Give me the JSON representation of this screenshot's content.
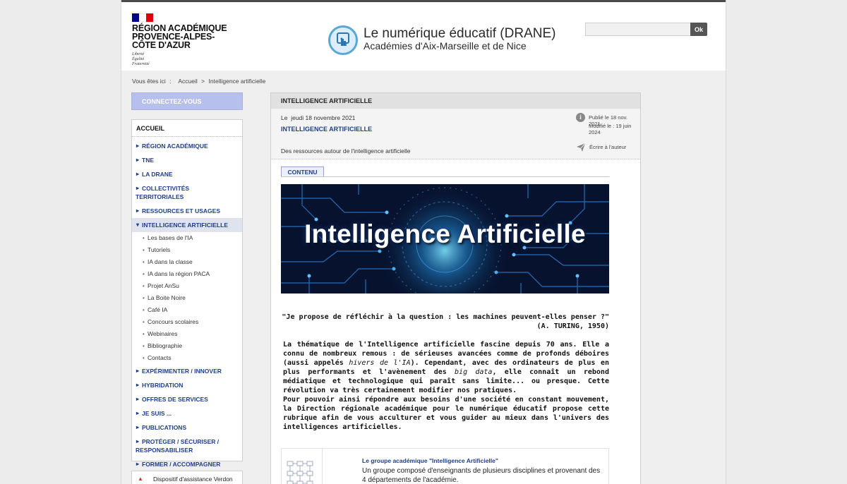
{
  "header": {
    "logo_lines": [
      "RÉGION ACADÉMIQUE",
      "PROVENCE-ALPES-",
      "CÔTE D'AZUR"
    ],
    "motto_lines": [
      "Liberté",
      "Égalité",
      "Fraternité"
    ],
    "site_title": "Le numérique éducatif (DRANE)",
    "site_subtitle": "Académies d'Aix-Marseille et de Nice",
    "search_button": "Ok",
    "search_value": ""
  },
  "breadcrumb": {
    "prefix": "Vous êtes ici",
    "separator": ":",
    "home": "Accueil",
    "arrow": ">",
    "current": "Intelligence artificielle"
  },
  "sidebar": {
    "connect_label": "CONNECTEZ-VOUS",
    "home_label": "ACCUEIL",
    "items": [
      {
        "label": "RÉGION ACADÉMIQUE"
      },
      {
        "label": "TNE"
      },
      {
        "label": "LA DRANE"
      },
      {
        "label": "COLLECTIVITÉS",
        "label2": "TERRITORIALES"
      },
      {
        "label": "RESSOURCES ET USAGES"
      },
      {
        "label": "INTELLIGENCE ARTIFICIELLE"
      },
      {
        "label": "EXPÉRIMENTER / INNOVER"
      },
      {
        "label": "HYBRIDATION"
      },
      {
        "label": "OFFRES DE SERVICES"
      },
      {
        "label": "JE SUIS ..."
      },
      {
        "label": "PUBLICATIONS"
      },
      {
        "label": "PROTÉGER / SÉCURISER /",
        "label2": "RESPONSABILISER"
      },
      {
        "label": "FORMER / ACCOMPAGNER"
      }
    ],
    "subitems": [
      "Les bases de l'IA",
      "Tutoriels",
      "IA dans la classe",
      "IA dans la région PACA",
      "Projet AnSu",
      "La Boite Noire",
      "Café IA",
      "Concours scolaires",
      "Webinaires",
      "Bibliographie",
      "Contacts"
    ],
    "assist_label": "Dispositif d'assistance Verdon"
  },
  "article": {
    "section_title": "INTELLIGENCE ARTIFICIELLE",
    "date_prefix": "Le",
    "date": "jeudi 18 novembre 2021",
    "title": "INTELLIGENCE ARTIFICIELLE",
    "description": "Des ressources autour de l'intelligence artificielle",
    "info_glyph": "i",
    "published": "Publié le 18 nov. 2021",
    "modified": "Modifié le : 19 juin 2024",
    "write_author": "Écrire à l'auteur",
    "tab_label": "CONTENU",
    "banner_title": "Intelligence Artificielle",
    "quote_line1": "\"Je propose de réfléchir à la question : les machines peuvent-elles penser ?\"",
    "quote_line2": "(A. TURING, 1950)",
    "para1_a": "La thématique de l'Intelligence artificielle fascine depuis 70 ans. Elle a connu de nombreux remous : de sérieuses avancées comme de profonds déboires (aussi appelés ",
    "para1_em1": "hivers de l'IA",
    "para1_b": "). Cependant, avec des ordinateurs de plus en plus performants et l'avènement des ",
    "para1_em2": "big data",
    "para1_c": ", elle connaît un rebond médiatique et technologique qui paraît sans limite... ou presque. Cette révolution va très certainement modifier nos pratiques.",
    "para2": "Pour pouvoir ainsi répondre aux besoins d'une société en constant mouvement, la Direction régionale académique pour le numérique éducatif propose cette rubrique afin de vous acculturer et vous guider au mieux dans l'univers des intelligences artificielles.",
    "group_title": "Le groupe académique \"Intelligence Artificielle\"",
    "group_text": "Un groupe composé d'enseignants de plusieurs disciplines et provenant des 4 départements de l'académie."
  },
  "colors": {
    "nav_blue": "#1f3f86",
    "connect_bg": "#b7c0ec",
    "flag_blue": "#000091",
    "flag_red": "#e1000f"
  }
}
